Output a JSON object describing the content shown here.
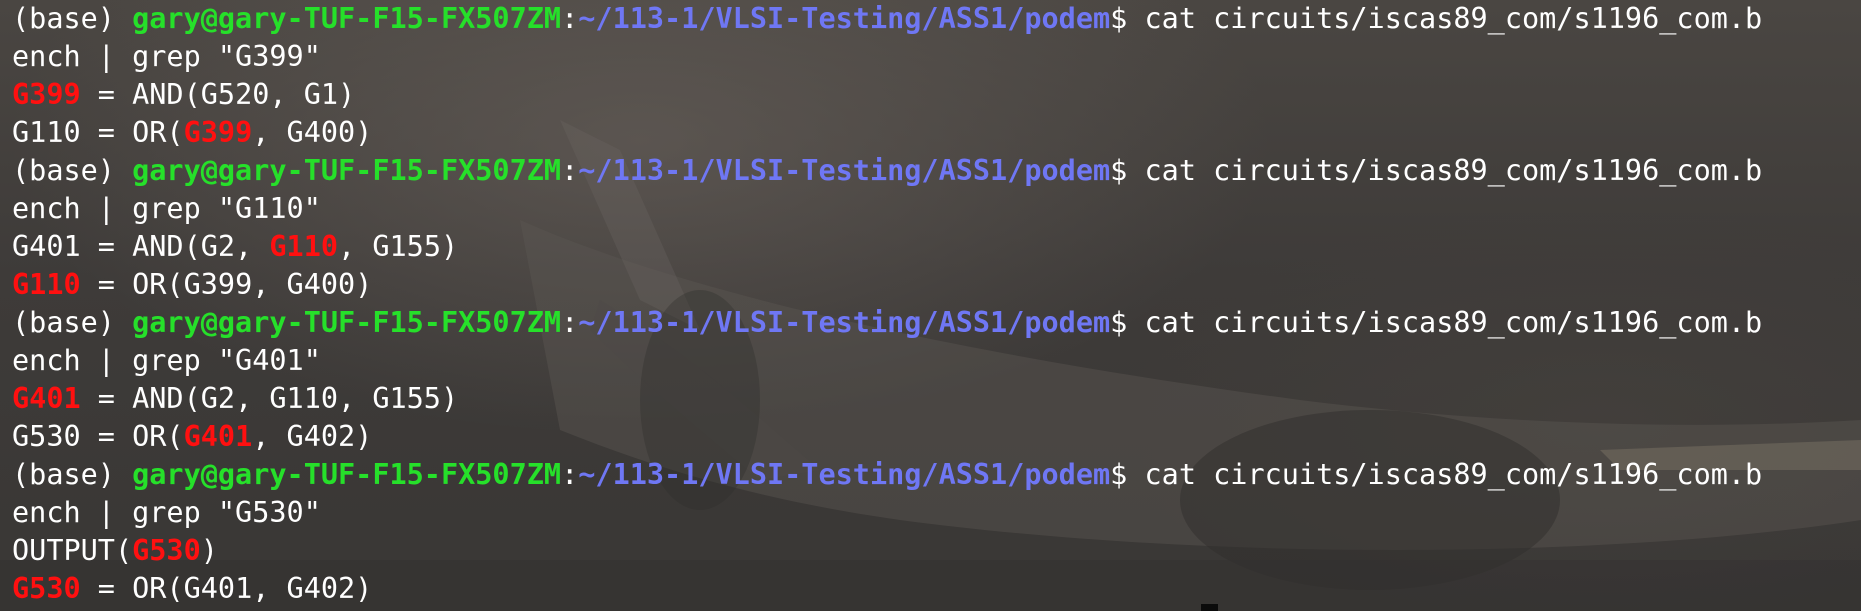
{
  "terminal": {
    "theme": {
      "background": "#3b3a38",
      "text": "#ffffff",
      "user_host": "#26e02a",
      "path": "#6f77f4",
      "grep_match": "#ff1010"
    },
    "lines": [
      {
        "type": "prompt",
        "env": "(base) ",
        "user_host": "gary@gary-TUF-F15-FX507ZM",
        "separator": ":",
        "cwd": "~/113-1/VLSI-Testing/ASS1/podem",
        "symbol": "$ ",
        "command_part1": "cat circuits/iscas89_com/s1196_com.b"
      },
      {
        "type": "wrap",
        "text": "ench | grep \"G399\""
      },
      {
        "type": "out",
        "before": "",
        "match": "G399",
        "after": " = AND(G520, G1)"
      },
      {
        "type": "out",
        "before": "G110 = OR(",
        "match": "G399",
        "after": ", G400)"
      },
      {
        "type": "prompt",
        "env": "(base) ",
        "user_host": "gary@gary-TUF-F15-FX507ZM",
        "separator": ":",
        "cwd": "~/113-1/VLSI-Testing/ASS1/podem",
        "symbol": "$ ",
        "command_part1": "cat circuits/iscas89_com/s1196_com.b"
      },
      {
        "type": "wrap",
        "text": "ench | grep \"G110\""
      },
      {
        "type": "out",
        "before": "G401 = AND(G2, ",
        "match": "G110",
        "after": ", G155)"
      },
      {
        "type": "out",
        "before": "",
        "match": "G110",
        "after": " = OR(G399, G400)"
      },
      {
        "type": "prompt",
        "env": "(base) ",
        "user_host": "gary@gary-TUF-F15-FX507ZM",
        "separator": ":",
        "cwd": "~/113-1/VLSI-Testing/ASS1/podem",
        "symbol": "$ ",
        "command_part1": "cat circuits/iscas89_com/s1196_com.b"
      },
      {
        "type": "wrap",
        "text": "ench | grep \"G401\""
      },
      {
        "type": "out",
        "before": "",
        "match": "G401",
        "after": " = AND(G2, G110, G155)"
      },
      {
        "type": "out",
        "before": "G530 = OR(",
        "match": "G401",
        "after": ", G402)"
      },
      {
        "type": "prompt",
        "env": "(base) ",
        "user_host": "gary@gary-TUF-F15-FX507ZM",
        "separator": ":",
        "cwd": "~/113-1/VLSI-Testing/ASS1/podem",
        "symbol": "$ ",
        "command_part1": "cat circuits/iscas89_com/s1196_com.b"
      },
      {
        "type": "wrap",
        "text": "ench | grep \"G530\""
      },
      {
        "type": "out",
        "before": "OUTPUT(",
        "match": "G530",
        "after": ")"
      },
      {
        "type": "out",
        "before": "",
        "match": "G530",
        "after": " = OR(G401, G402)"
      }
    ]
  }
}
